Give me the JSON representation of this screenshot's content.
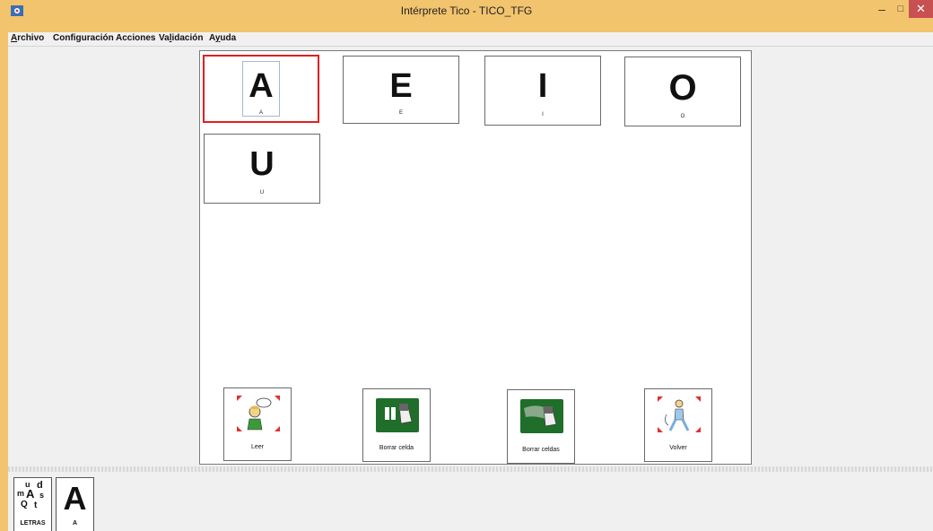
{
  "window": {
    "title": "Intérprete Tico - TICO_TFG",
    "minimize_glyph": "–",
    "maximize_glyph": "□",
    "close_glyph": "✕",
    "titlebar_color": "#f2c46e",
    "close_color": "#c75050"
  },
  "menu": {
    "items": [
      "Archivo",
      "Configuración",
      "Acciones",
      "Validación",
      "Ayuda"
    ]
  },
  "board": {
    "cells": [
      {
        "symbol": "A",
        "label": "A",
        "selected": true
      },
      {
        "symbol": "E",
        "label": "E",
        "selected": false
      },
      {
        "symbol": "I",
        "label": "I",
        "selected": false
      },
      {
        "symbol": "O",
        "label": "O",
        "selected": false
      },
      {
        "symbol": "U",
        "label": "U",
        "selected": false
      }
    ],
    "actions": [
      {
        "label": "Leer",
        "icon": "person-speaking-icon"
      },
      {
        "label": "Borrar celda",
        "icon": "erase-cell-icon"
      },
      {
        "label": "Borrar celdas",
        "icon": "erase-cells-icon"
      },
      {
        "label": "Volver",
        "icon": "walking-person-icon"
      }
    ],
    "selection_color": "#e02020"
  },
  "history": {
    "items": [
      {
        "label": "LETRAS",
        "icon": "letters-icon",
        "glyphs": [
          "u",
          "d",
          "m",
          "A",
          "s",
          "Q",
          "t"
        ]
      },
      {
        "label": "A",
        "symbol": "A"
      }
    ]
  }
}
